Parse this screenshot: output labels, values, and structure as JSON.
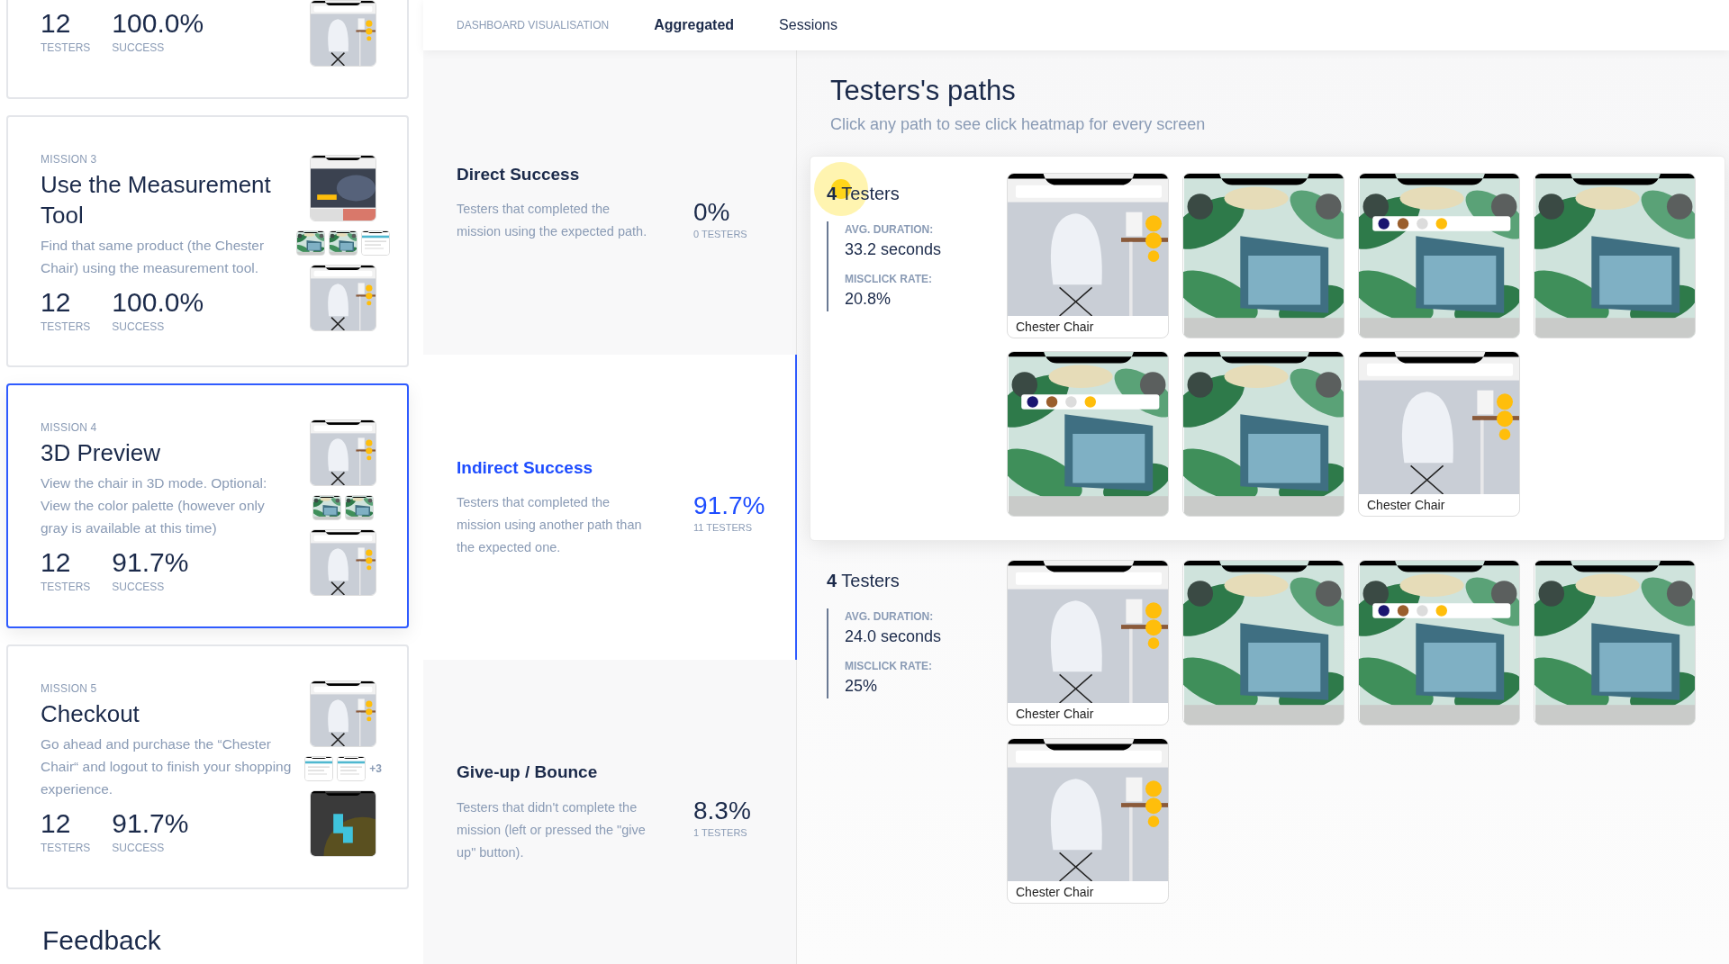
{
  "nav": {
    "title": "DASHBOARD VISUALISATION",
    "tabs": [
      {
        "label": "Aggregated",
        "selected": true
      },
      {
        "label": "Sessions",
        "selected": false
      }
    ]
  },
  "missions": [
    {
      "testers": "12",
      "testers_label": "TESTERS",
      "success": "100.0%",
      "success_label": "SUCCESS",
      "selected": false,
      "thumbnails": [
        {
          "kind": "chair"
        }
      ]
    },
    {
      "label": "MISSION 3",
      "title": "Use the Measurement Tool",
      "description": "Find that same product (the Chester Chair) using the measurement tool.",
      "testers": "12",
      "testers_label": "TESTERS",
      "success": "100.0%",
      "success_label": "SUCCESS",
      "selected": false,
      "thumbnails": [
        {
          "kind": "home"
        },
        {
          "kind": "minis",
          "screens": [
            {
              "kind": "plants"
            },
            {
              "kind": "plants"
            },
            {
              "kind": "list"
            }
          ]
        },
        {
          "kind": "chair"
        }
      ]
    },
    {
      "label": "MISSION 4",
      "title": "3D Preview",
      "description": "View the chair in 3D mode. Optional: View the color palette (however only gray is available at this time)",
      "testers": "12",
      "testers_label": "TESTERS",
      "success": "91.7%",
      "success_label": "SUCCESS",
      "selected": true,
      "thumbnails": [
        {
          "kind": "chair"
        },
        {
          "kind": "minis",
          "screens": [
            {
              "kind": "plants"
            },
            {
              "kind": "plants"
            }
          ]
        },
        {
          "kind": "chair"
        }
      ]
    },
    {
      "label": "MISSION 5",
      "title": "Checkout",
      "description": "Go ahead and purchase the “Chester Chair“ and logout to finish your shopping experience.",
      "testers": "12",
      "testers_label": "TESTERS",
      "success": "91.7%",
      "success_label": "SUCCESS",
      "selected": false,
      "thumbnails": [
        {
          "kind": "chair"
        },
        {
          "kind": "minis",
          "screens": [
            {
              "kind": "list"
            },
            {
              "kind": "list"
            }
          ],
          "more": "+3"
        },
        {
          "kind": "dark"
        }
      ]
    }
  ],
  "feedback_heading": "Feedback",
  "outcomes": [
    {
      "title": "Direct Success",
      "description": "Testers that completed the mission using the expected path.",
      "percent": "0%",
      "count": "0 TESTERS",
      "selected": false
    },
    {
      "title": "Indirect Success",
      "description": "Testers that completed the mission using another path than the expected one.",
      "percent": "91.7%",
      "count": "11 TESTERS",
      "selected": true
    },
    {
      "title": "Give-up / Bounce",
      "description": "Testers that didn't complete the mission (left or pressed the \"give up\" button).",
      "percent": "8.3%",
      "count": "1 TESTERS",
      "selected": false
    }
  ],
  "paths": {
    "title": "Testers's paths",
    "subtitle": "Click any path to see click heatmap for every screen",
    "groups": [
      {
        "testers": "**4** Testers",
        "selected": true,
        "click_marker": true,
        "stats": [
          {
            "label": "AVG. DURATION:",
            "value": "33.2 seconds"
          },
          {
            "label": "MISCLICK RATE:",
            "value": "20.8%"
          }
        ],
        "screens": [
          {
            "kind": "chair",
            "caption": "Chester Chair"
          },
          {
            "kind": "plants"
          },
          {
            "kind": "plants-palette"
          },
          {
            "kind": "plants"
          },
          {
            "kind": "plants-palette"
          },
          {
            "kind": "plants"
          },
          {
            "kind": "chair",
            "caption": "Chester Chair"
          }
        ]
      },
      {
        "testers": "**4** Testers",
        "selected": false,
        "click_marker": false,
        "stats": [
          {
            "label": "AVG. DURATION:",
            "value": "24.0 seconds"
          },
          {
            "label": "MISCLICK RATE:",
            "value": "25%"
          }
        ],
        "screens": [
          {
            "kind": "chair",
            "caption": "Chester Chair"
          },
          {
            "kind": "plants"
          },
          {
            "kind": "plants-palette"
          },
          {
            "kind": "plants"
          },
          {
            "kind": "chair",
            "caption": "Chester Chair"
          }
        ]
      }
    ]
  }
}
